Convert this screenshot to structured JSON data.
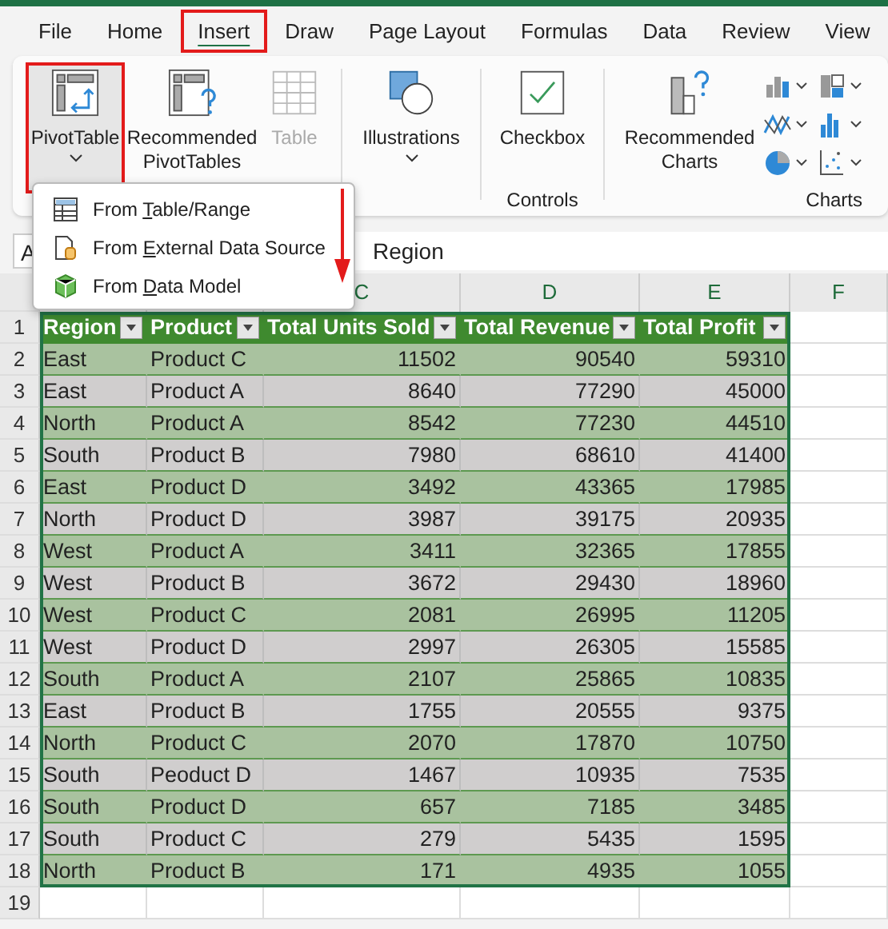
{
  "tabs": [
    {
      "label": "File",
      "selected": false,
      "highlighted": false
    },
    {
      "label": "Home",
      "selected": false,
      "highlighted": false
    },
    {
      "label": "Insert",
      "selected": true,
      "highlighted": true
    },
    {
      "label": "Draw",
      "selected": false,
      "highlighted": false
    },
    {
      "label": "Page Layout",
      "selected": false,
      "highlighted": false
    },
    {
      "label": "Formulas",
      "selected": false,
      "highlighted": false
    },
    {
      "label": "Data",
      "selected": false,
      "highlighted": false
    },
    {
      "label": "Review",
      "selected": false,
      "highlighted": false
    },
    {
      "label": "View",
      "selected": false,
      "highlighted": false
    }
  ],
  "ribbon": {
    "groups": [
      {
        "items": [
          {
            "kind": "pivot",
            "label": "PivotTable",
            "caret": true,
            "disabled": false,
            "highlighted": true
          },
          {
            "kind": "recommended-pivot",
            "label": "Recommended PivotTables",
            "caret": false,
            "disabled": false,
            "highlighted": false
          },
          {
            "kind": "table",
            "label": "Table",
            "caret": false,
            "disabled": true,
            "highlighted": false
          }
        ]
      },
      {
        "items": [
          {
            "kind": "illustrations",
            "label": "Illustrations",
            "caret": true,
            "disabled": false,
            "highlighted": false
          }
        ]
      },
      {
        "label": "Controls",
        "items": [
          {
            "kind": "checkbox",
            "label": "Checkbox",
            "caret": false,
            "disabled": false,
            "highlighted": false
          }
        ]
      },
      {
        "label": "Charts",
        "items": [
          {
            "kind": "recommended-charts",
            "label": "Recommended Charts",
            "caret": false,
            "disabled": false,
            "highlighted": false
          },
          {
            "kind": "chart-gallery"
          }
        ]
      }
    ]
  },
  "menu": {
    "items": [
      {
        "kind": "table-range",
        "before": "From ",
        "key": "T",
        "after": "able/Range"
      },
      {
        "kind": "external",
        "before": "From ",
        "key": "E",
        "after": "xternal Data Source"
      },
      {
        "kind": "data-model",
        "before": "From ",
        "key": "D",
        "after": "ata Model"
      }
    ]
  },
  "formula_bar": {
    "name_box": "A",
    "value": "Region"
  },
  "columns": [
    {},
    {},
    {
      "header": "C"
    },
    {
      "header": "D"
    },
    {
      "header": "E"
    },
    {
      "header": "F"
    }
  ],
  "table": {
    "headers": [
      "Region",
      "Product",
      "Total Units Sold",
      "Total Revenue",
      "Total Profit"
    ],
    "rows": [
      [
        "East",
        "Product C",
        "11502",
        "90540",
        "59310"
      ],
      [
        "East",
        "Product A",
        "8640",
        "77290",
        "45000"
      ],
      [
        "North",
        "Product A",
        "8542",
        "77230",
        "44510"
      ],
      [
        "South",
        "Product B",
        "7980",
        "68610",
        "41400"
      ],
      [
        "East",
        "Product D",
        "3492",
        "43365",
        "17985"
      ],
      [
        "North",
        "Product D",
        "3987",
        "39175",
        "20935"
      ],
      [
        "West",
        "Product A",
        "3411",
        "32365",
        "17855"
      ],
      [
        "West",
        "Product B",
        "3672",
        "29430",
        "18960"
      ],
      [
        "West",
        "Product C",
        "2081",
        "26995",
        "11205"
      ],
      [
        "West",
        "Product D",
        "2997",
        "26305",
        "15585"
      ],
      [
        "South",
        "Product A",
        "2107",
        "25865",
        "10835"
      ],
      [
        "East",
        "Product B",
        "1755",
        "20555",
        "9375"
      ],
      [
        "North",
        "Product C",
        "2070",
        "17870",
        "10750"
      ],
      [
        "South",
        "Peoduct D",
        "1467",
        "10935",
        "7535"
      ],
      [
        "South",
        "Product D",
        "657",
        "7185",
        "3485"
      ],
      [
        "South",
        "Product C",
        "279",
        "5435",
        "1595"
      ],
      [
        "North",
        "Product B",
        "171",
        "4935",
        "1055"
      ]
    ]
  },
  "row_numbers": [
    "1",
    "2",
    "3",
    "4",
    "5",
    "6",
    "7",
    "8",
    "9",
    "10",
    "11",
    "12",
    "13",
    "14",
    "15",
    "16",
    "17",
    "18",
    "19"
  ]
}
